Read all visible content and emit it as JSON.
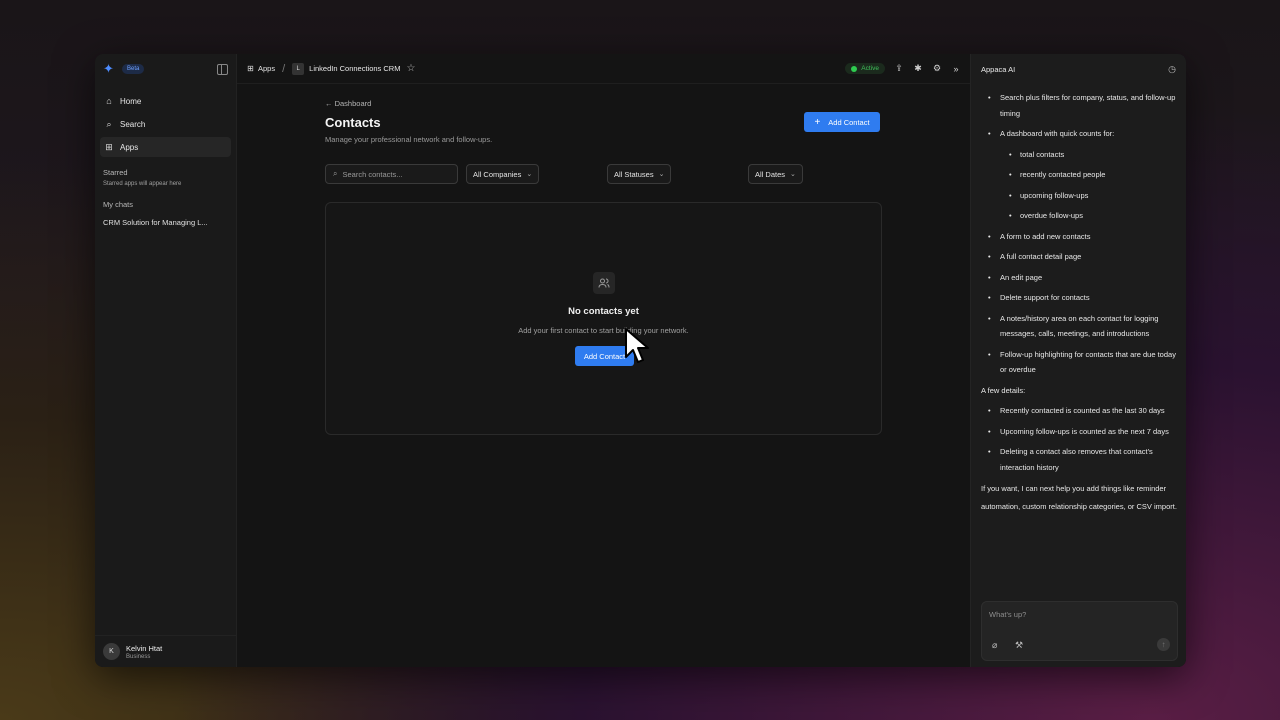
{
  "sidebar": {
    "beta_label": "Beta",
    "nav": [
      {
        "label": "Home",
        "icon": "home-icon",
        "glyph": "⌂"
      },
      {
        "label": "Search",
        "icon": "search-icon",
        "glyph": "⌕"
      },
      {
        "label": "Apps",
        "icon": "grid-icon",
        "glyph": "⊞"
      }
    ],
    "starred_heading": "Starred",
    "starred_note": "Starred apps will appear here",
    "chats_heading": "My chats",
    "chats": [
      "CRM Solution for Managing L..."
    ],
    "user": {
      "initial": "K",
      "name": "Kelvin Htat",
      "plan": "Business"
    }
  },
  "topbar": {
    "apps_label": "Apps",
    "app_badge": "L",
    "app_title": "LinkedIn Connections CRM",
    "status": "Active"
  },
  "main": {
    "back_label": "Dashboard",
    "title": "Contacts",
    "subtitle": "Manage your professional network and follow-ups.",
    "add_button": "Add Contact",
    "search_placeholder": "Search contacts...",
    "filters": [
      "All Companies",
      "All Statuses",
      "All Dates"
    ],
    "empty_title": "No contacts yet",
    "empty_subtitle": "Add your first contact to start building your network.",
    "empty_button": "Add Contact"
  },
  "assistant": {
    "title": "Appaca AI",
    "bullets_a": [
      "Search plus filters for company, status, and follow-up timing",
      "A dashboard with quick counts for:"
    ],
    "counts": [
      "total contacts",
      "recently contacted people",
      "upcoming follow-ups",
      "overdue follow-ups"
    ],
    "bullets_b": [
      "A form to add new contacts",
      "A full contact detail page",
      "An edit page",
      "Delete support for contacts",
      "A notes/history area on each contact for logging messages, calls, meetings, and introductions",
      "Follow-up highlighting for contacts that are due today or overdue"
    ],
    "details_heading": "A few details:",
    "details": [
      "Recently contacted is counted as the last 30 days",
      "Upcoming follow-ups is counted as the next 7 days",
      "Deleting a contact also removes that contact's interaction history"
    ],
    "closing": "If you want, I can next help you add things like reminder automation, custom relationship categories, or CSV import.",
    "composer_placeholder": "What's up?"
  },
  "colors": {
    "accent": "#2f7cf0",
    "status_green": "#2ecc50",
    "background": "#141414"
  }
}
